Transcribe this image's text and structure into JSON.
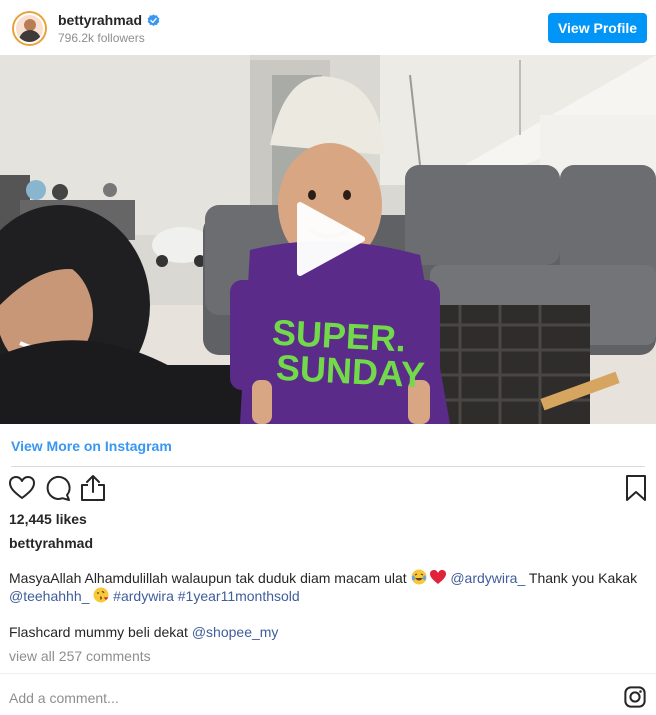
{
  "post": {
    "username": "bettyrahmad",
    "followers": "796.2k followers",
    "view_profile_label": "View Profile",
    "view_more_label": "View More on Instagram",
    "likes": "12,445 likes",
    "owner": "bettyrahmad",
    "caption": {
      "text_1": "MasyaAllah Alhamdulillah walaupun tak duduk diam macam ulat",
      "mention_1": "@ardywira_",
      "text_2": "Thank you Kakak",
      "mention_2": "@teehahhh_",
      "hashtag_1": "#ardywira",
      "hashtag_2": "#1year11monthsold",
      "text_3": "Flashcard mummy beli dekat",
      "mention_3": "@shopee_my"
    },
    "view_comments": "view all 257 comments",
    "add_comment_placeholder": "Add a comment...",
    "video_shirt_text": [
      "SUPER.",
      "SUNDAY"
    ]
  },
  "icons": {
    "verified": "verified-badge-icon",
    "play": "play-icon",
    "like": "heart-icon",
    "comment": "comment-icon",
    "share": "share-icon",
    "save": "bookmark-icon",
    "instagram": "instagram-logo-icon",
    "emoji_1": "laughing-tears-emoji",
    "emoji_2": "red-heart-emoji",
    "emoji_3": "kiss-emoji"
  },
  "colors": {
    "accent": "#0095f6",
    "link": "#3897f0",
    "mention": "#3f5d9a",
    "muted": "#8e8e8e"
  }
}
